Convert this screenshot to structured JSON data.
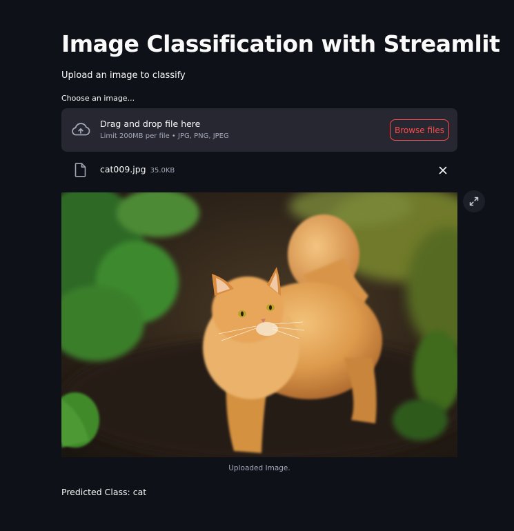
{
  "page": {
    "title": "Image Classification with Streamlit",
    "subtitle": "Upload an image to classify"
  },
  "uploader": {
    "label": "Choose an image...",
    "dropzone_text": "Drag and drop file here",
    "limit_text": "Limit 200MB per file • JPG, PNG, JPEG",
    "browse_label": "Browse files",
    "upload_icon": "cloud-upload-icon"
  },
  "file": {
    "name": "cat009.jpg",
    "size": "35.0KB",
    "file_icon": "file-icon",
    "remove_icon": "close-icon"
  },
  "image": {
    "caption": "Uploaded Image.",
    "fullscreen_icon": "expand-icon"
  },
  "result": {
    "prediction_text": "Predicted Class: cat"
  },
  "colors": {
    "background": "#0e1117",
    "dropzone": "#262730",
    "accent": "#ff4b4b",
    "text": "#fafafa",
    "muted": "#a3a8b8"
  }
}
